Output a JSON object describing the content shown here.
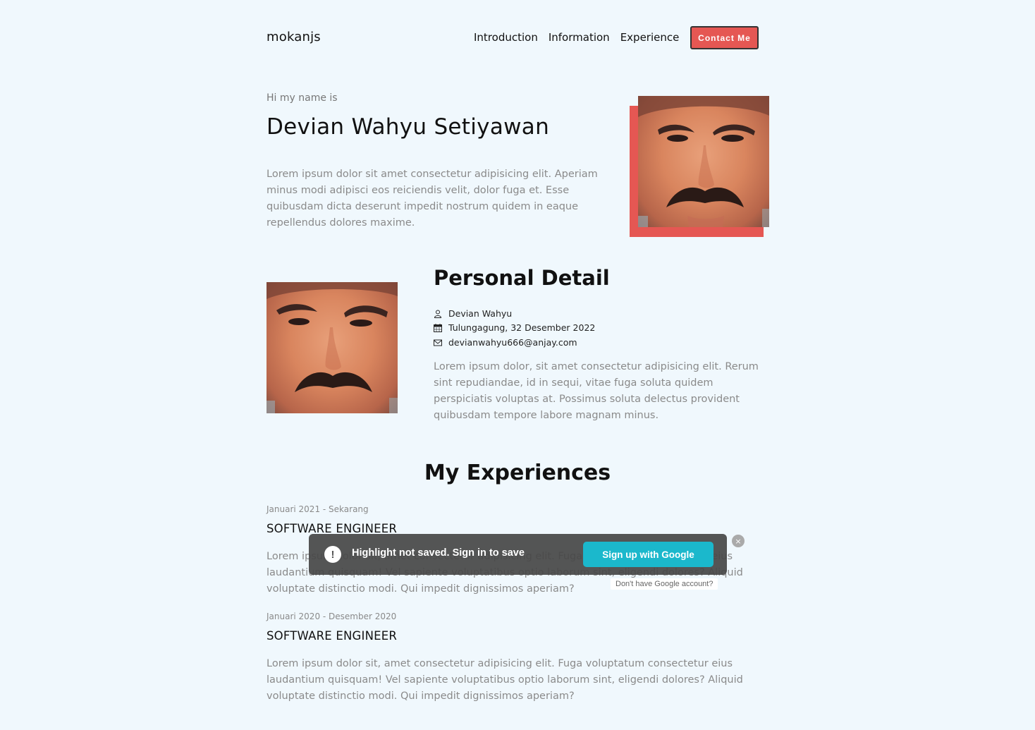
{
  "header": {
    "brand": "mokanjs",
    "nav": [
      "Introduction",
      "Information",
      "Experience"
    ],
    "contact_label": "Contact Me"
  },
  "hero": {
    "greeting": "Hi my name is",
    "name": "Devian Wahyu Setiyawan",
    "text": "Lorem ipsum dolor sit amet consectetur adipisicing elit. Aperiam minus modi adipisci eos reiciendis velit, dolor fuga et. Esse quibusdam dicta deserunt impedit nostrum quidem in eaque repellendus dolores maxime."
  },
  "personal": {
    "title": "Personal Detail",
    "name": "Devian Wahyu",
    "birth": "Tulungagung, 32 Desember 2022",
    "email": "devianwahyu666@anjay.com",
    "text": "Lorem ipsum dolor, sit amet consectetur adipisicing elit. Rerum sint repudiandae, id in sequi, vitae fuga soluta quidem perspiciatis voluptas at. Possimus soluta delectus provident quibusdam tempore labore magnam minus."
  },
  "experiences": {
    "title": "My Experiences",
    "items": [
      {
        "date": "Januari 2021 - Sekarang",
        "role": "SOFTWARE ENGINEER",
        "desc": "Lorem ipsum dolor sit, amet consectetur adipisicing elit. Fuga voluptatum consectetur eius laudantium quisquam! Vel sapiente voluptatibus optio laborum sint, eligendi dolores? Aliquid voluptate distinctio modi. Qui impedit dignissimos aperiam?"
      },
      {
        "date": "Januari 2020 - Desember 2020",
        "role": "SOFTWARE ENGINEER",
        "desc": "Lorem ipsum dolor sit, amet consectetur adipisicing elit. Fuga voluptatum consectetur eius laudantium quisquam! Vel sapiente voluptatibus optio laborum sint, eligendi dolores? Aliquid voluptate distinctio modi. Qui impedit dignissimos aperiam?"
      }
    ]
  },
  "toast": {
    "icon": "!",
    "message": "Highlight not saved. Sign in to save",
    "button": "Sign up with Google",
    "no_account": "Don't have Google account?",
    "close": "×"
  },
  "colors": {
    "background": "#f0f8fd",
    "accent": "#e55753",
    "google_button": "#1bb8cc"
  }
}
